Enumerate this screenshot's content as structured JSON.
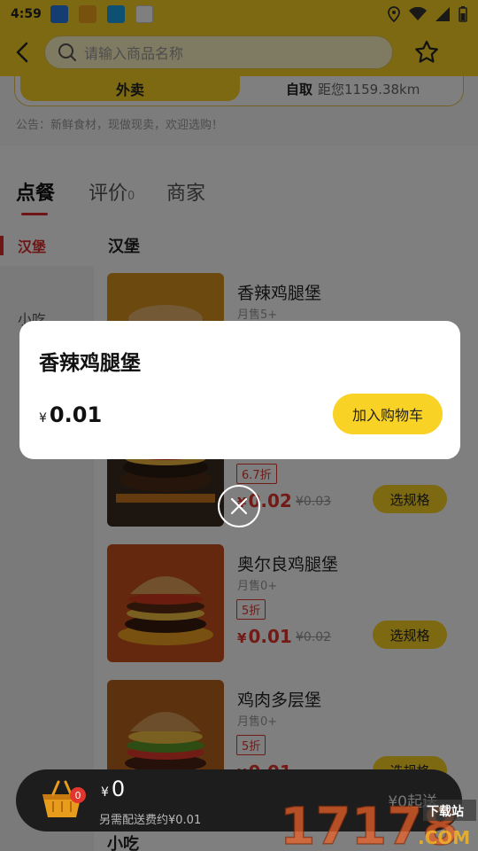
{
  "status_bar": {
    "time": "4:59"
  },
  "header": {
    "search_placeholder": "请输入商品名称"
  },
  "delivery": {
    "takeout_label": "外卖",
    "pickup_label": "自取",
    "distance": "距您1159.38km",
    "notice": "公告：新鲜食材，现做现卖，欢迎选购！"
  },
  "tabs": [
    {
      "label": "点餐",
      "count": ""
    },
    {
      "label": "评价",
      "count": "0"
    },
    {
      "label": "商家",
      "count": ""
    }
  ],
  "categories": [
    {
      "label": "汉堡"
    },
    {
      "label": "小吃"
    }
  ],
  "section_title": "汉堡",
  "products": [
    {
      "name": "香辣鸡腿堡",
      "sales": "月售5+",
      "discount": "",
      "price": "",
      "orig_price": "",
      "button": ""
    },
    {
      "name": "",
      "sales": "",
      "discount": "6.7折",
      "price": "0.02",
      "orig_price": "¥0.03",
      "button": "选规格"
    },
    {
      "name": "奥尔良鸡腿堡",
      "sales": "月售0+",
      "discount": "5折",
      "price": "0.01",
      "orig_price": "¥0.02",
      "button": "选规格"
    },
    {
      "name": "鸡肉多层堡",
      "sales": "月售0+",
      "discount": "5折",
      "price": "0.01",
      "orig_price": "",
      "button": "选规格"
    }
  ],
  "currency": "¥",
  "popup": {
    "title": "香辣鸡腿堡",
    "price": "0.01",
    "add_to_cart": "加入购物车"
  },
  "cart": {
    "count": "0",
    "total": "0",
    "delivery_note": "另需配送费约¥0.01",
    "min_order": "¥0起送"
  },
  "bottom_section": "小吃",
  "watermark": {
    "text": "17178",
    "suffix": ".COM",
    "tag": "下载站"
  },
  "colors": {
    "brand_yellow": "#f8d224",
    "price_red": "#e2352d",
    "cart_bar": "#1d1d1d"
  }
}
